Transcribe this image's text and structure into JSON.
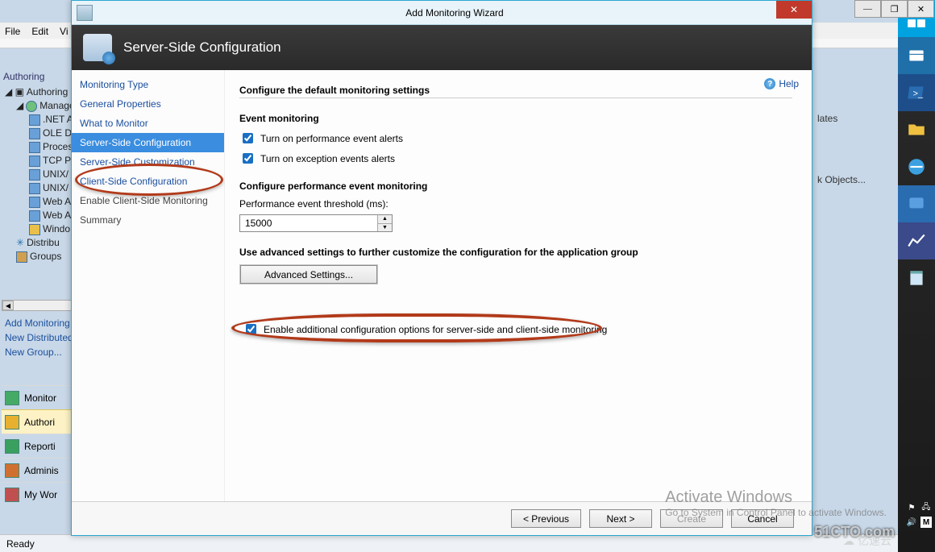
{
  "parent_window": {
    "menu": [
      "File",
      "Edit",
      "Vi"
    ],
    "minimize": "―",
    "restore": "❐",
    "close": "✕"
  },
  "authoring": {
    "heading": "Authoring",
    "root": "Authoring",
    "mgmt": "Manage",
    "nodes": [
      ".NET A",
      "OLE D",
      "Proces",
      "TCP Po",
      "UNIX/",
      "UNIX/",
      "Web A",
      "Web A",
      "Windo",
      "Distribu",
      "Groups"
    ],
    "links": [
      "Add Monitoring",
      "New Distributed",
      "New Group..."
    ]
  },
  "nav_sections": [
    "Monitor",
    "Authori",
    "Reporti",
    "Adminis",
    "My Wor"
  ],
  "statusbar": {
    "text": "Ready"
  },
  "right_panel": {
    "lates": "lates",
    "objects": "k Objects..."
  },
  "wizard": {
    "title": "Add Monitoring Wizard",
    "close": "✕",
    "header": "Server-Side Configuration",
    "help": "Help",
    "nav": [
      "Monitoring Type",
      "General Properties",
      "What to Monitor",
      "Server-Side Configuration",
      "Server-Side Customization",
      "Client-Side Configuration",
      "Enable Client-Side Monitoring",
      "Summary"
    ],
    "main": {
      "heading": "Configure the default monitoring settings",
      "event_title": "Event monitoring",
      "cb_perf": "Turn on performance event alerts",
      "cb_exc": "Turn on exception events alerts",
      "perf_title": "Configure performance event monitoring",
      "perf_label": "Performance event threshold (ms):",
      "perf_value": "15000",
      "adv_text": "Use advanced settings to further customize the configuration for the application group",
      "adv_button": "Advanced Settings...",
      "cb_enable": "Enable additional configuration options for server-side and client-side monitoring"
    },
    "footer": {
      "prev": "< Previous",
      "next": "Next >",
      "create": "Create",
      "cancel": "Cancel"
    }
  },
  "watermark": {
    "l1": "Activate Windows",
    "l2": "Go to System in Control Panel to activate Windows."
  },
  "branding": {
    "cto": "51CTO.com",
    "ys": "亿速云"
  }
}
